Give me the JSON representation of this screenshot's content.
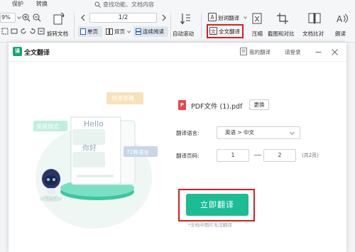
{
  "menu": {
    "protect": "保护",
    "convert": "转换",
    "search_placeholder": "查找功能、文档内容"
  },
  "toolbar": {
    "zoom": "9%",
    "page_input": "1/2",
    "rotate_doc": "旋转文档",
    "single_page": "单页",
    "double_page": "双页",
    "continuous_read": "连续阅读",
    "auto_scroll": "自动滚动",
    "word_translate": "划词翻译",
    "full_translate": "全文翻译",
    "compress": "压缩",
    "screenshot_compare": "截图和对比",
    "doc_compare": "文档比对",
    "read_aloud": "朗读"
  },
  "dialog": {
    "title": "全文翻译",
    "my_translations": "我的翻译",
    "login": "请登录",
    "illustration": {
      "hello": "Hello",
      "nihao": "你好",
      "fast_accurate": "快速准确",
      "keep_format": "保留版式",
      "langs_72": "72种语言"
    },
    "file_name": "PDF文件 (1).pdf",
    "change_button": "更换",
    "language_label": "翻译语言:",
    "language_value": "英语 > 中文",
    "pages_label": "翻译页码:",
    "page_from": "1",
    "page_to": "2",
    "total_pages": "(共2页)",
    "translate_button": "立即翻译",
    "note": "*文档中图片无法翻译"
  },
  "colors": {
    "accent": "#1cbc94",
    "highlight": "#d81e1e",
    "pdf_red": "#e5484d"
  }
}
